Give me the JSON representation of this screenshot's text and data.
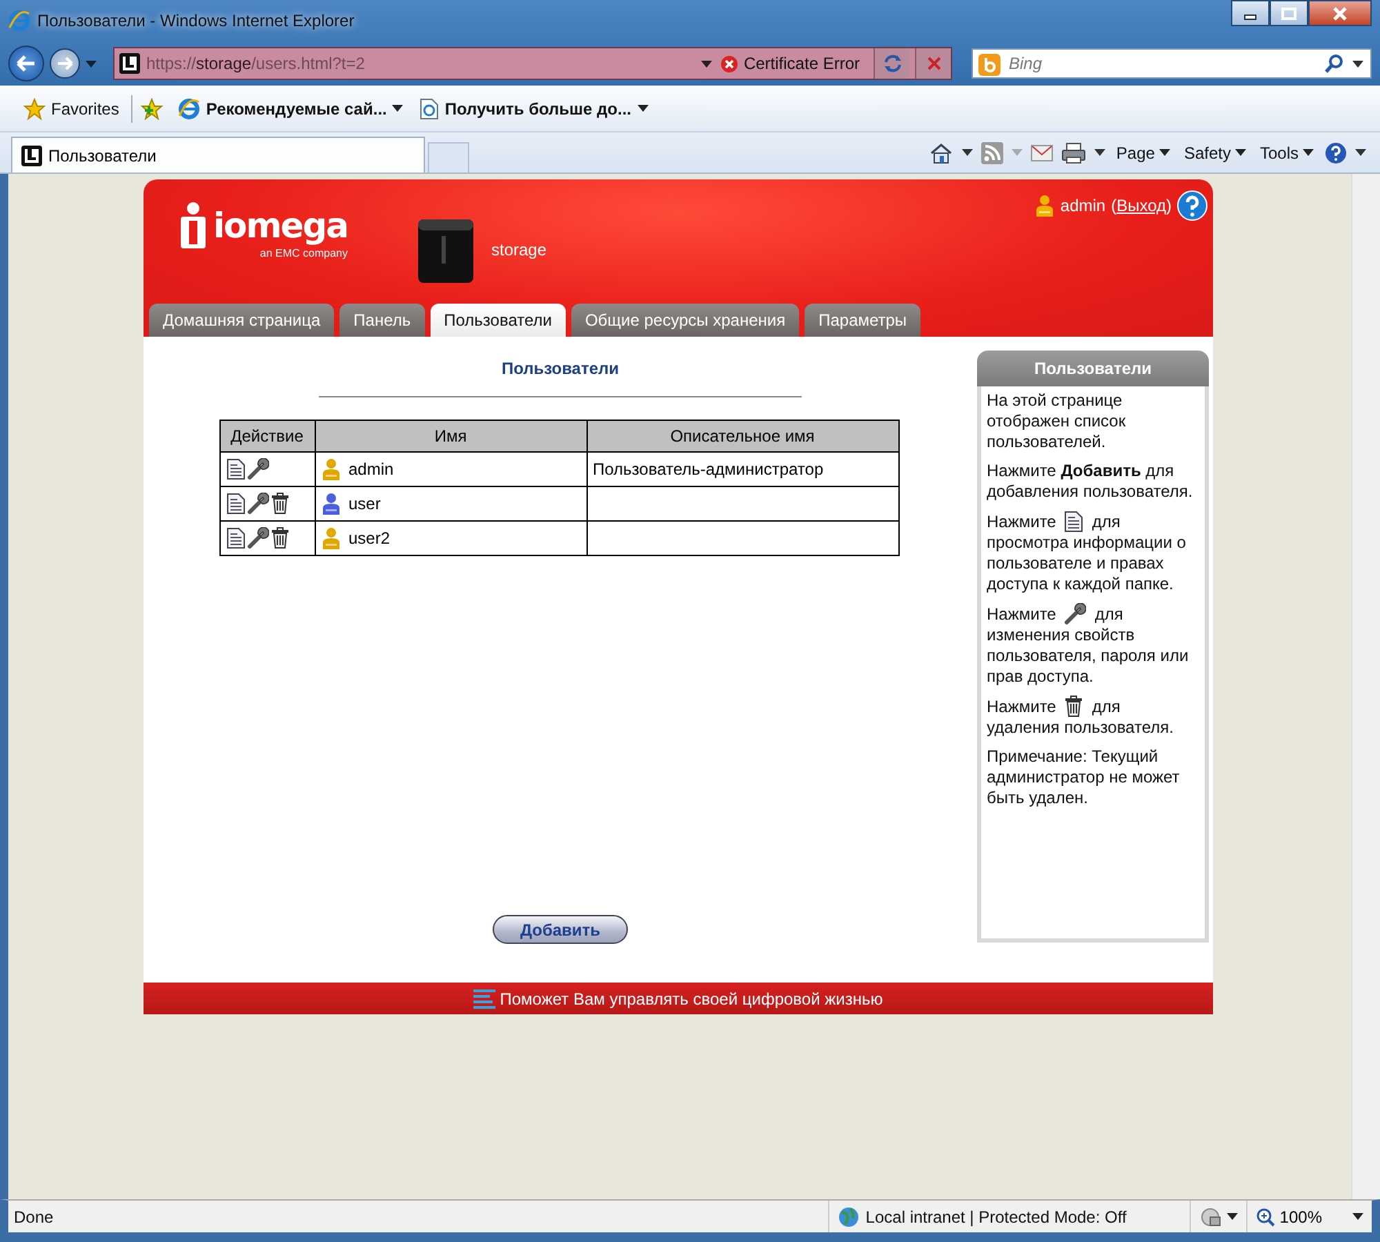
{
  "window": {
    "title": "Пользователи - Windows Internet Explorer"
  },
  "address_bar": {
    "scheme": "https://",
    "host": "storage",
    "path": "/users.html?t=2",
    "certificate": "Certificate Error"
  },
  "search": {
    "placeholder": "Bing"
  },
  "favorites_bar": {
    "favorites": "Favorites",
    "links": [
      "Рекомендуемые сай...",
      "Получить больше до..."
    ]
  },
  "browser_tabs": [
    {
      "label": "Пользователи",
      "selected": true
    }
  ],
  "command_bar": [
    "Page",
    "Safety",
    "Tools"
  ],
  "app": {
    "logo": "iomega",
    "logo_sub": "an EMC company",
    "device": "storage",
    "user": "admin",
    "logout_open": "(",
    "logout": "Выход",
    "logout_close": ")",
    "tabs": [
      {
        "label": "Домашняя страница",
        "selected": false
      },
      {
        "label": "Панель",
        "selected": false
      },
      {
        "label": "Пользователи",
        "selected": true
      },
      {
        "label": "Общие ресурсы хранения",
        "selected": false
      },
      {
        "label": "Параметры",
        "selected": false
      }
    ],
    "heading": "Пользователи",
    "table": {
      "columns": [
        "Действие",
        "Имя",
        "Описательное имя"
      ],
      "rows": [
        {
          "deletable": false,
          "name": "admin",
          "color": "#e0a800",
          "description": "Пользователь-администратор"
        },
        {
          "deletable": true,
          "name": "user",
          "color": "#4a5ee0"
        },
        {
          "deletable": true,
          "name": "user2",
          "color": "#e0a800"
        }
      ]
    },
    "add_button": "Добавить",
    "help": {
      "title": "Пользователи",
      "paragraphs": [
        {
          "text": "На этой странице отображен список пользователей."
        },
        {
          "text": "Нажмите **Добавить** для добавления пользователя."
        },
        {
          "kind": "view",
          "before": "Нажмите",
          "middle": "для",
          "after": "просмотра информации о пользователе и правах доступа к каждой папке."
        },
        {
          "kind": "edit",
          "before": "Нажмите",
          "middle": "для",
          "after": "изменения свойств пользователя, пароля или прав доступа."
        },
        {
          "kind": "delete",
          "before": "Нажмите",
          "middle": "для",
          "after": "удаления пользователя."
        },
        {
          "text": "Примечание: Текущий администратор не может быть удален."
        }
      ]
    },
    "footer": "Поможет Вам управлять своей цифровой жизнью"
  },
  "status_bar": {
    "status": "Done",
    "zone": "Local intranet | Protected Mode: Off",
    "zoom": "100%"
  }
}
